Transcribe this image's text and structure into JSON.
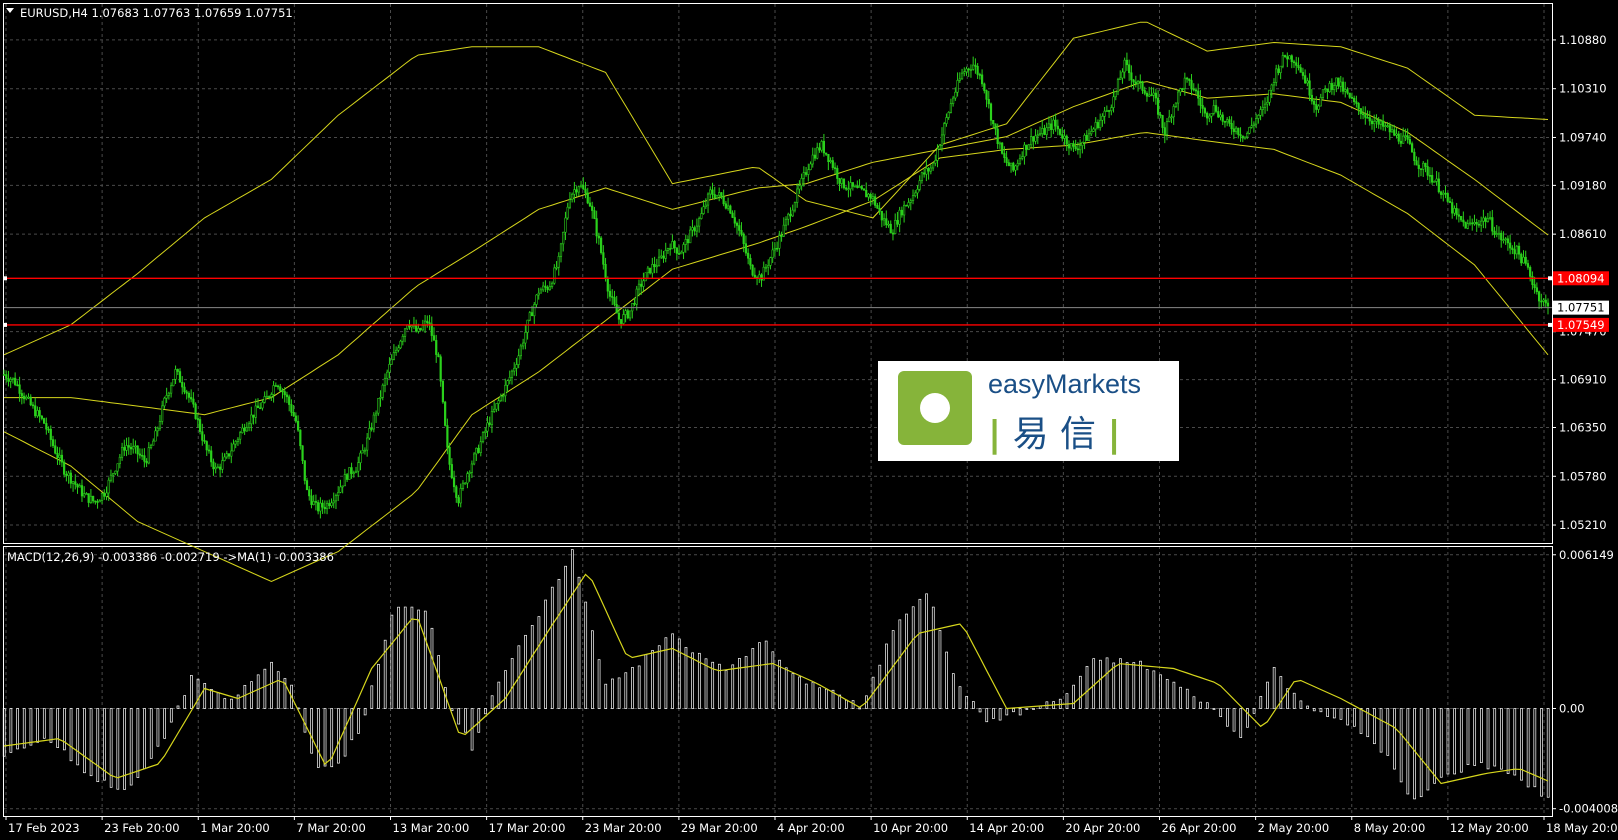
{
  "window": {
    "symbol_header": "EURUSD,H4  1.07683 1.07763 1.07659 1.07751",
    "macd_header": "MACD(12,26,9) -0.003386 -0.002719  ->MA(1) -0.003386",
    "watermark": {
      "brand": "easyMarkets",
      "chinese": "易 信"
    }
  },
  "colors": {
    "background": "#000000",
    "grid": "#4a4a4a",
    "candle_up": "#2bd21c",
    "bands": "#d6d61c",
    "hline": "#ff0000",
    "histogram": "#ffffff",
    "signal": "#d6d61c",
    "logo_green": "#86b43a",
    "logo_blue": "#1a4f86"
  },
  "chart_data": [
    {
      "type": "line",
      "panel": "price",
      "title": "EURUSD,H4",
      "indicators": "Bollinger Bands (upper, middle, lower)",
      "y_ticks": [
        "1.10880",
        "1.10310",
        "1.09740",
        "1.09180",
        "1.08610",
        "1.07470",
        "1.06910",
        "1.06350",
        "1.05780",
        "1.05210"
      ],
      "ylim": [
        1.05,
        1.113
      ],
      "x_labels": [
        "17 Feb 2023",
        "23 Feb 20:00",
        "1 Mar 20:00",
        "7 Mar 20:00",
        "13 Mar 20:00",
        "17 Mar 20:00",
        "23 Mar 20:00",
        "29 Mar 20:00",
        "4 Apr 20:00",
        "10 Apr 20:00",
        "14 Apr 20:00",
        "20 Apr 20:00",
        "26 Apr 20:00",
        "2 May 20:00",
        "8 May 20:00",
        "12 May 20:00",
        "18 May 20:00"
      ],
      "horizontal_lines": [
        {
          "value": 1.08094,
          "label": "1.08094",
          "color": "#ff0000"
        },
        {
          "value": 1.07751,
          "label": "1.07751",
          "color": "#ffffff"
        },
        {
          "value": 1.07549,
          "label": "1.07549",
          "color": "#ff0000"
        }
      ],
      "close_series": [
        1.0697,
        1.069,
        1.0672,
        1.0655,
        1.064,
        1.061,
        1.0585,
        1.057,
        1.0555,
        1.0548,
        1.056,
        1.0588,
        1.0615,
        1.0608,
        1.0595,
        1.0625,
        1.067,
        1.07,
        1.068,
        1.065,
        1.061,
        1.0585,
        1.0598,
        1.062,
        1.064,
        1.0655,
        1.0668,
        1.069,
        1.067,
        1.064,
        1.056,
        1.054,
        1.0545,
        1.056,
        1.058,
        1.059,
        1.062,
        1.066,
        1.07,
        1.073,
        1.076,
        1.0745,
        1.076,
        1.0718,
        1.06,
        1.055,
        1.0585,
        1.061,
        1.064,
        1.0665,
        1.069,
        1.072,
        1.076,
        1.0795,
        1.08,
        1.083,
        1.0905,
        1.092,
        1.09,
        1.085,
        1.079,
        1.076,
        1.077,
        1.08,
        1.082,
        1.083,
        1.085,
        1.084,
        1.086,
        1.088,
        1.091,
        1.0905,
        1.089,
        1.086,
        1.082,
        1.081,
        1.0835,
        1.086,
        1.089,
        1.092,
        1.095,
        1.0965,
        1.0945,
        1.092,
        1.0915,
        1.091,
        1.0905,
        1.088,
        1.0865,
        1.089,
        1.0905,
        1.093,
        1.094,
        1.098,
        1.102,
        1.105,
        1.106,
        1.104,
        1.099,
        1.095,
        1.0935,
        1.096,
        1.0975,
        1.098,
        1.099,
        1.0975,
        1.096,
        1.097,
        1.0985,
        1.1,
        1.102,
        1.106,
        1.104,
        1.103,
        1.102,
        1.098,
        1.1015,
        1.104,
        1.103,
        1.1,
        1.101,
        1.099,
        1.0985,
        1.0975,
        1.0995,
        1.101,
        1.105,
        1.107,
        1.1065,
        1.104,
        1.101,
        1.103,
        1.104,
        1.1025,
        1.101,
        1.1,
        1.099,
        1.0985,
        1.0975,
        1.097,
        1.0945,
        1.0935,
        1.092,
        1.09,
        1.088,
        1.087,
        1.0875,
        1.088,
        1.086,
        1.085,
        1.084,
        1.082,
        1.079,
        1.0775
      ],
      "upper_band": [
        [
          0,
          1.072
        ],
        [
          30,
          1.0755
        ],
        [
          60,
          1.0815
        ],
        [
          90,
          1.088
        ],
        [
          120,
          1.0925
        ],
        [
          150,
          1.1
        ],
        [
          185,
          1.107
        ],
        [
          210,
          1.108
        ],
        [
          240,
          1.108
        ],
        [
          270,
          1.105
        ],
        [
          300,
          1.092
        ],
        [
          338,
          1.094
        ],
        [
          360,
          1.09
        ],
        [
          390,
          1.088
        ],
        [
          420,
          1.0965
        ],
        [
          450,
          1.099
        ],
        [
          480,
          1.109
        ],
        [
          512,
          1.111
        ],
        [
          540,
          1.1075
        ],
        [
          570,
          1.1085
        ],
        [
          600,
          1.108
        ],
        [
          630,
          1.1055
        ],
        [
          660,
          1.1
        ],
        [
          693,
          1.0995
        ]
      ],
      "middle_band": [
        [
          0,
          1.067
        ],
        [
          30,
          1.067
        ],
        [
          60,
          1.066
        ],
        [
          90,
          1.065
        ],
        [
          120,
          1.067
        ],
        [
          150,
          1.072
        ],
        [
          185,
          1.08
        ],
        [
          210,
          1.084
        ],
        [
          240,
          1.089
        ],
        [
          270,
          1.0915
        ],
        [
          300,
          1.089
        ],
        [
          338,
          1.0915
        ],
        [
          360,
          1.092
        ],
        [
          390,
          1.0945
        ],
        [
          420,
          1.096
        ],
        [
          450,
          1.0975
        ],
        [
          480,
          1.101
        ],
        [
          512,
          1.104
        ],
        [
          540,
          1.102
        ],
        [
          570,
          1.1025
        ],
        [
          600,
          1.1015
        ],
        [
          630,
          1.098
        ],
        [
          660,
          1.0925
        ],
        [
          693,
          1.086
        ]
      ],
      "lower_band": [
        [
          0,
          1.063
        ],
        [
          30,
          1.059
        ],
        [
          60,
          1.0525
        ],
        [
          90,
          1.049
        ],
        [
          120,
          1.0455
        ],
        [
          150,
          1.049
        ],
        [
          185,
          1.056
        ],
        [
          210,
          1.065
        ],
        [
          240,
          1.07
        ],
        [
          270,
          1.076
        ],
        [
          300,
          1.082
        ],
        [
          338,
          1.085
        ],
        [
          360,
          1.087
        ],
        [
          390,
          1.09
        ],
        [
          420,
          1.095
        ],
        [
          450,
          1.096
        ],
        [
          480,
          1.0965
        ],
        [
          512,
          1.098
        ],
        [
          540,
          1.097
        ],
        [
          570,
          1.096
        ],
        [
          600,
          1.093
        ],
        [
          630,
          1.0885
        ],
        [
          660,
          1.0825
        ],
        [
          693,
          1.072
        ]
      ]
    },
    {
      "type": "bar",
      "panel": "MACD",
      "title": "MACD(12,26,9)",
      "y_ticks": [
        "0.006149",
        "0.00",
        "-0.004008"
      ],
      "ylim": [
        -0.0043,
        0.0065
      ],
      "histogram": [
        [
          0,
          -0.0018
        ],
        [
          20,
          -0.0012
        ],
        [
          40,
          -0.0028
        ],
        [
          56,
          -0.0033
        ],
        [
          70,
          -0.0015
        ],
        [
          85,
          0.0014
        ],
        [
          100,
          0.0002
        ],
        [
          120,
          0.0018
        ],
        [
          130,
          0.0008
        ],
        [
          140,
          -0.0025
        ],
        [
          150,
          -0.0022
        ],
        [
          160,
          -0.0008
        ],
        [
          175,
          0.004
        ],
        [
          190,
          0.004
        ],
        [
          200,
          0.0002
        ],
        [
          210,
          -0.0016
        ],
        [
          220,
          0.0008
        ],
        [
          240,
          0.0037
        ],
        [
          255,
          0.0063
        ],
        [
          270,
          0.001
        ],
        [
          285,
          0.0018
        ],
        [
          300,
          0.003
        ],
        [
          310,
          0.0022
        ],
        [
          325,
          0.0015
        ],
        [
          340,
          0.0028
        ],
        [
          355,
          0.0012
        ],
        [
          370,
          0.0008
        ],
        [
          385,
          0.0
        ],
        [
          400,
          0.0034
        ],
        [
          415,
          0.0048
        ],
        [
          425,
          0.0015
        ],
        [
          440,
          -0.0005
        ],
        [
          455,
          -0.0002
        ],
        [
          475,
          0.0004
        ],
        [
          490,
          0.002
        ],
        [
          510,
          0.0018
        ],
        [
          525,
          0.001
        ],
        [
          540,
          0.0002
        ],
        [
          555,
          -0.0012
        ],
        [
          570,
          0.0016
        ],
        [
          580,
          0.0004
        ],
        [
          595,
          -0.0003
        ],
        [
          610,
          -0.001
        ],
        [
          620,
          -0.0018
        ],
        [
          632,
          -0.0038
        ],
        [
          645,
          -0.0028
        ],
        [
          660,
          -0.0022
        ],
        [
          675,
          -0.0025
        ],
        [
          693,
          -0.0036
        ]
      ],
      "signal": [
        [
          0,
          -0.0015
        ],
        [
          25,
          -0.0012
        ],
        [
          50,
          -0.0028
        ],
        [
          70,
          -0.0022
        ],
        [
          90,
          0.0008
        ],
        [
          105,
          0.0004
        ],
        [
          125,
          0.0012
        ],
        [
          145,
          -0.0024
        ],
        [
          165,
          0.0016
        ],
        [
          185,
          0.0038
        ],
        [
          205,
          -0.0012
        ],
        [
          225,
          0.0004
        ],
        [
          245,
          0.0032
        ],
        [
          262,
          0.0055
        ],
        [
          280,
          0.002
        ],
        [
          300,
          0.0024
        ],
        [
          320,
          0.0015
        ],
        [
          345,
          0.0018
        ],
        [
          365,
          0.001
        ],
        [
          385,
          0.0
        ],
        [
          410,
          0.003
        ],
        [
          430,
          0.0034
        ],
        [
          450,
          0.0
        ],
        [
          480,
          0.0002
        ],
        [
          500,
          0.0018
        ],
        [
          525,
          0.0016
        ],
        [
          545,
          0.001
        ],
        [
          565,
          -0.0008
        ],
        [
          580,
          0.0012
        ],
        [
          600,
          0.0004
        ],
        [
          625,
          -0.0008
        ],
        [
          645,
          -0.003
        ],
        [
          665,
          -0.0026
        ],
        [
          680,
          -0.0024
        ],
        [
          693,
          -0.0029
        ]
      ]
    }
  ]
}
